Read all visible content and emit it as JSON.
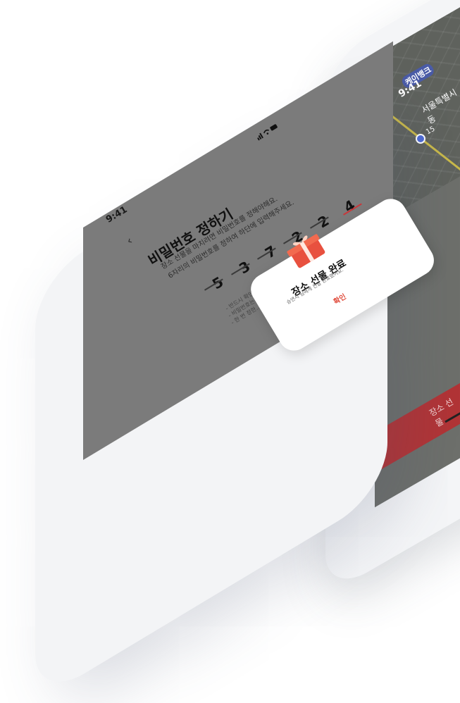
{
  "front_phone": {
    "status_bar": {
      "time": "9:41",
      "indicators": "signal wifi battery"
    },
    "page_title": "비밀번호 정하기",
    "description": [
      "장소 선물을 마치려면 비밀번호를 정해야해요.",
      "6자리의 비밀번호를 정하여 하단에 입력해주세요."
    ],
    "pin_digits": [
      "5",
      "3",
      "7",
      "2",
      "2",
      "4"
    ],
    "notes": [
      "- 반드시 확인...",
      "- 비밀번호는...",
      "- 한 번 정한..."
    ],
    "modal": {
      "title": "장소 선물 완료",
      "message": "승연시 님에게 전달 완료했어요.",
      "confirm_label": "확인"
    }
  },
  "back_phone": {
    "status_bar": {
      "carrier": "케이뱅크",
      "time": "9:41"
    },
    "address": "서울특별시 동",
    "pin_label": "15",
    "cta_label": "장소 선물"
  },
  "colors": {
    "accent_red": "#c8383b",
    "modal_confirm": "#e04a3a",
    "screen_dim": "#7b7b7b"
  }
}
